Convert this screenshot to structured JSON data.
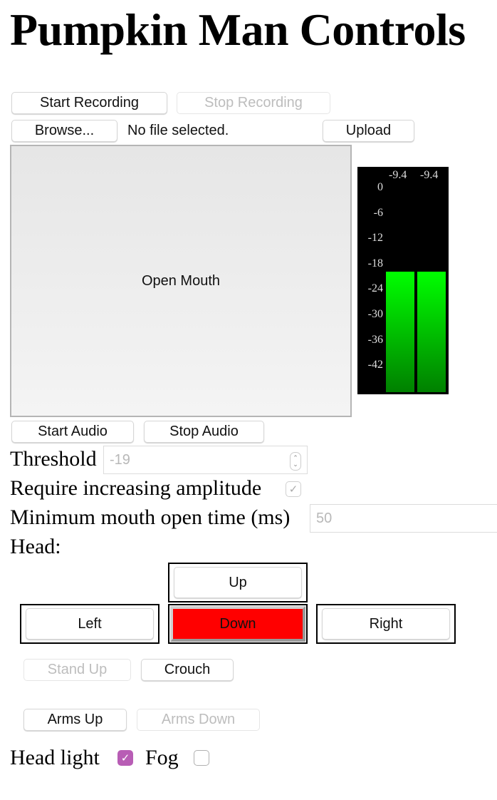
{
  "title": "Pumpkin Man Controls",
  "recording": {
    "start_label": "Start Recording",
    "stop_label": "Stop Recording",
    "stop_disabled": true
  },
  "file": {
    "browse_label": "Browse...",
    "status": "No file selected.",
    "upload_label": "Upload"
  },
  "mouth": {
    "label": "Open Mouth"
  },
  "meter": {
    "peak_labels": [
      "-9.4",
      "-9.4"
    ],
    "scale": [
      "0",
      "-6",
      "-12",
      "-18",
      "-24",
      "-30",
      "-36",
      "-42"
    ],
    "levels_db": [
      -18,
      -18
    ],
    "range_db": [
      -48,
      5
    ],
    "colors": {
      "background": "#000000",
      "bar_top": "#00ff00",
      "bar_bottom": "#008000"
    }
  },
  "audio": {
    "start_label": "Start Audio",
    "stop_label": "Stop Audio"
  },
  "threshold": {
    "label": "Threshold",
    "value": "-19"
  },
  "increasing": {
    "label": "Require increasing amplitude",
    "checked": true,
    "disabled": true
  },
  "min_open": {
    "label": "Minimum mouth open time (ms)",
    "value": "50"
  },
  "head": {
    "label": "Head:",
    "up_label": "Up",
    "left_label": "Left",
    "down_label": "Down",
    "right_label": "Right",
    "active": "Down",
    "active_color": "#ff0000"
  },
  "body": {
    "stand_label": "Stand Up",
    "crouch_label": "Crouch",
    "stand_disabled": true
  },
  "arms": {
    "up_label": "Arms Up",
    "down_label": "Arms Down",
    "down_disabled": true
  },
  "toggles": {
    "headlight_label": "Head light",
    "headlight_checked": true,
    "headlight_color": "#b85db5",
    "fog_label": "Fog",
    "fog_checked": false
  }
}
